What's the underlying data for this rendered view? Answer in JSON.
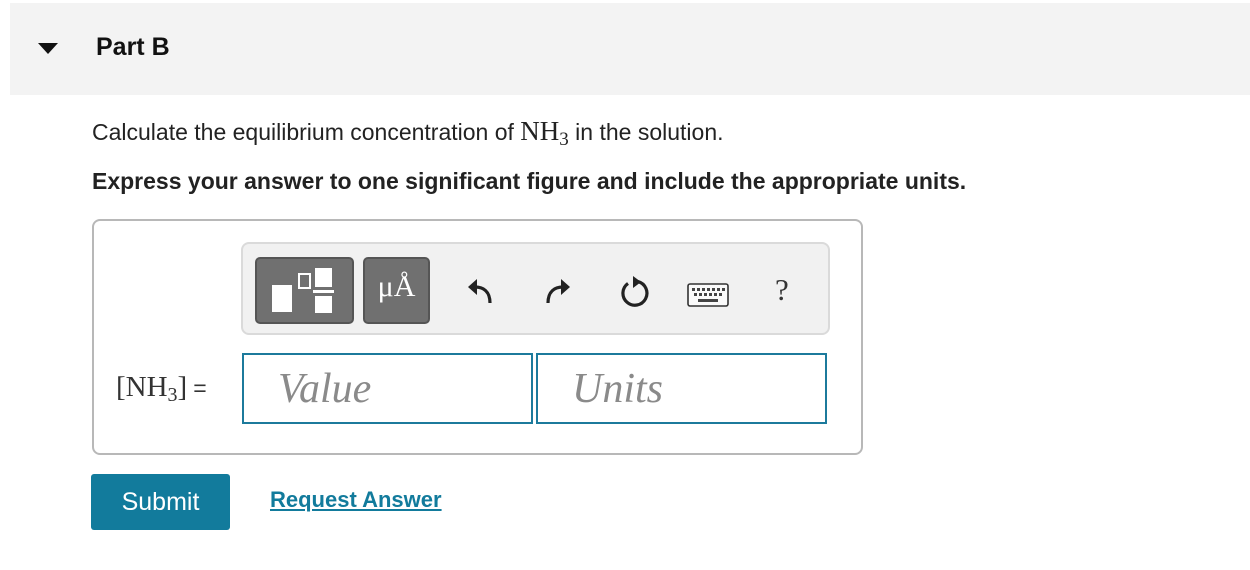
{
  "part": {
    "title": "Part B"
  },
  "question": {
    "prefix": "Calculate the equilibrium concentration of ",
    "formula_base": "NH",
    "formula_sub": "3",
    "suffix": " in the solution."
  },
  "instruction": "Express your answer to one significant figure and include the appropriate units.",
  "toolbar": {
    "units_button_label": "μÅ",
    "help_label": "?",
    "icons": [
      "templates-icon",
      "units-icon",
      "undo-icon",
      "redo-icon",
      "reset-icon",
      "keyboard-icon",
      "help-icon"
    ]
  },
  "answer": {
    "label_base": "[NH",
    "label_sub": "3",
    "label_close": "]",
    "equals": "=",
    "value_placeholder": "Value",
    "units_placeholder": "Units"
  },
  "actions": {
    "submit_label": "Submit",
    "request_answer_label": "Request Answer"
  },
  "colors": {
    "accent": "#127b9c",
    "field_border": "#1c7a9c",
    "header_bg": "#f3f3f3",
    "toolbar_button": "#707070"
  }
}
